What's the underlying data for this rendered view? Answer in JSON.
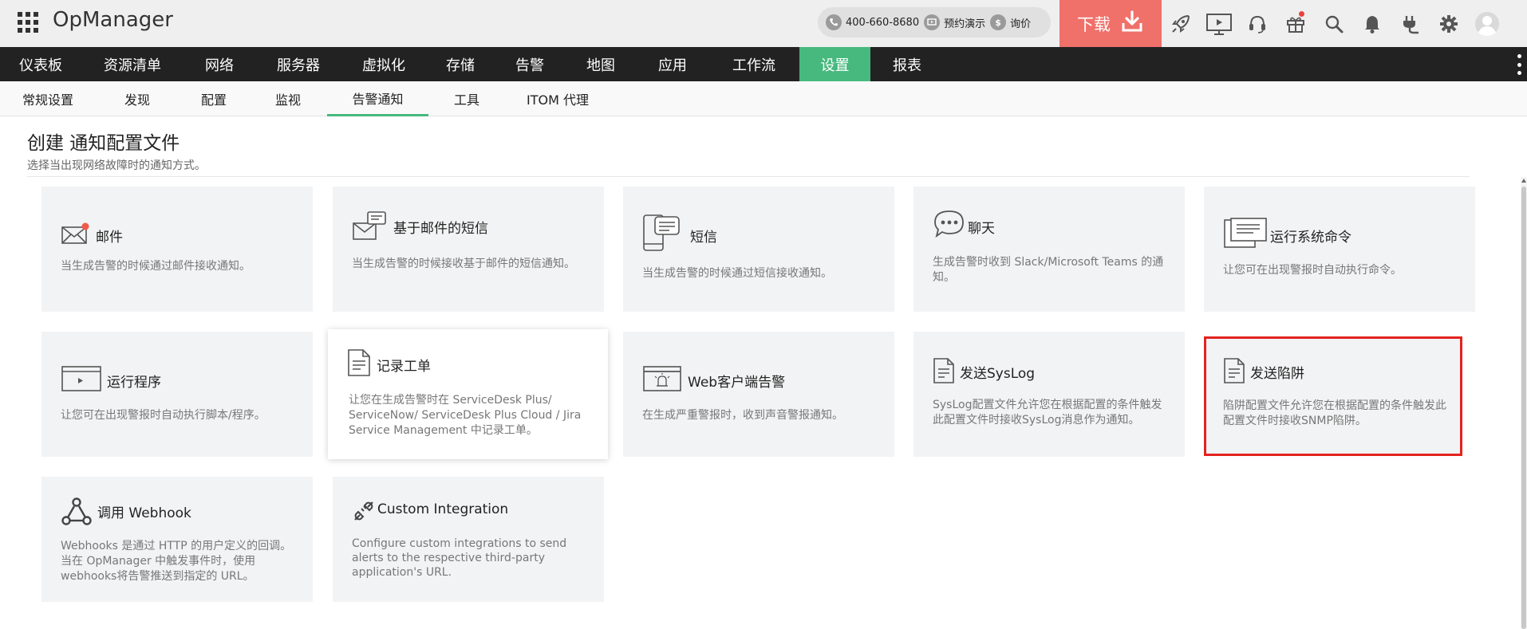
{
  "header": {
    "app_name": "OpManager",
    "phone": "400-660-8680",
    "demo": "预约演示",
    "price": "询价",
    "download": "下载",
    "icons": [
      "apps-grid-icon",
      "phone-icon",
      "demo-icon",
      "dollar-icon",
      "download-icon",
      "rocket-icon",
      "presentation-icon",
      "headset-icon",
      "gift-icon",
      "search-icon",
      "bell-icon",
      "plug-icon",
      "gear-icon",
      "user-avatar-icon"
    ]
  },
  "main_nav": {
    "items": [
      "仪表板",
      "资源清单",
      "网络",
      "服务器",
      "虚拟化",
      "存储",
      "告警",
      "地图",
      "应用",
      "工作流",
      "设置",
      "报表"
    ],
    "active": "设置",
    "active_color": "#47b97e"
  },
  "sub_nav": {
    "items": [
      "常规设置",
      "发现",
      "配置",
      "监视",
      "告警通知",
      "工具",
      "ITOM 代理"
    ],
    "active": "告警通知"
  },
  "page": {
    "title": "创建 通知配置文件",
    "subtitle": "选择当出现网络故障时的通知方式。"
  },
  "cards": [
    {
      "title": "邮件",
      "desc": "当生成告警的时候通过邮件接收通知。",
      "icon": "envelope-icon"
    },
    {
      "title": "基于邮件的短信",
      "desc": "当生成告警的时候接收基于邮件的短信通知。",
      "icon": "email-sms-icon"
    },
    {
      "title": "短信",
      "desc": "当生成告警的时候通过短信接收通知。",
      "icon": "sms-icon"
    },
    {
      "title": "聊天",
      "desc": "生成告警时收到 Slack/Microsoft Teams 的通知。",
      "icon": "chat-icon"
    },
    {
      "title": "运行系统命令",
      "desc": "让您可在出现警报时自动执行命令。",
      "icon": "system-command-icon"
    },
    {
      "title": "运行程序",
      "desc": "让您可在出现警报时自动执行脚本/程序。",
      "icon": "run-program-icon"
    },
    {
      "title": "记录工单",
      "desc": "让您在生成告警时在 ServiceDesk Plus/ ServiceNow/ ServiceDesk Plus Cloud / Jira Service Management 中记录工单。",
      "icon": "ticket-icon"
    },
    {
      "title": "Web客户端告警",
      "desc": "在生成严重警报时，收到声音警报通知。",
      "icon": "web-alarm-icon"
    },
    {
      "title": "发送SysLog",
      "desc": "SysLog配置文件允许您在根据配置的条件触发此配置文件时接收SysLog消息作为通知。",
      "icon": "syslog-document-icon"
    },
    {
      "title": "发送陷阱",
      "desc": "陷阱配置文件允许您在根据配置的条件触发此配置文件时接收SNMP陷阱。",
      "icon": "trap-document-icon"
    },
    {
      "title": "调用 Webhook",
      "desc": "Webhooks 是通过 HTTP 的用户定义的回调。 当在 OpManager 中触发事件时，使用 webhooks将告警推送到指定的 URL。",
      "icon": "webhook-icon"
    },
    {
      "title": "Custom Integration",
      "desc": "Configure custom integrations to send alerts to the respective third-party application's URL.",
      "icon": "custom-integration-icon"
    }
  ],
  "colors": {
    "accent": "#47b97e",
    "download": "#f0706a",
    "selected_border": "#e3231f",
    "card_bg": "#f2f3f4",
    "nav_bg": "#222222"
  }
}
